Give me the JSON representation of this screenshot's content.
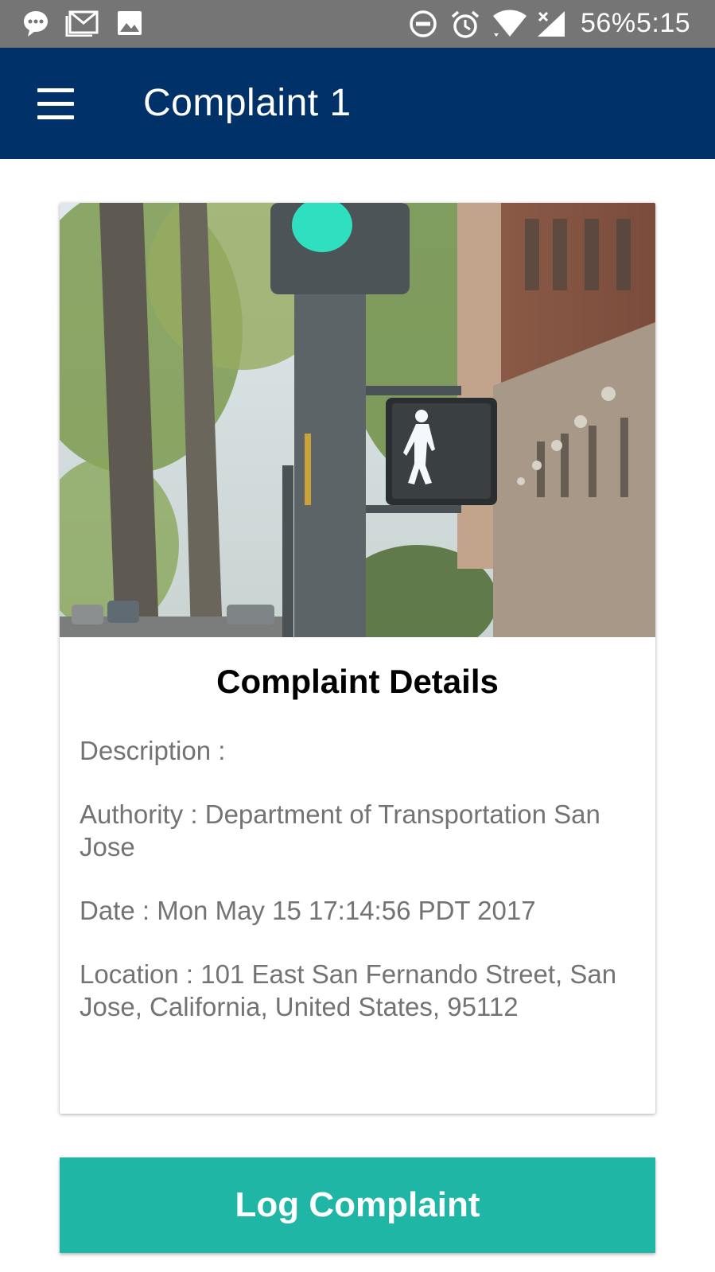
{
  "status_bar": {
    "battery": "56%",
    "time": "5:15",
    "icons": [
      "message-icon",
      "gmail-icon",
      "image-icon",
      "dnd-icon",
      "alarm-icon",
      "wifi-icon",
      "signal-icon"
    ]
  },
  "app_bar": {
    "menu_icon": "hamburger-menu-icon",
    "title": "Complaint 1",
    "background": "#003169"
  },
  "card": {
    "photo_alt": "Pedestrian walk signal at a street corner",
    "title": "Complaint Details",
    "description": "Description :",
    "authority": "Authority : Department of Transportation San Jose",
    "date": "Date : Mon May 15 17:14:56 PDT 2017",
    "location": "Location : 101 East San Fernando Street, San Jose, California, United States, 95112"
  },
  "actions": {
    "log_complaint": "Log Complaint",
    "accent": "#20b6a6"
  }
}
